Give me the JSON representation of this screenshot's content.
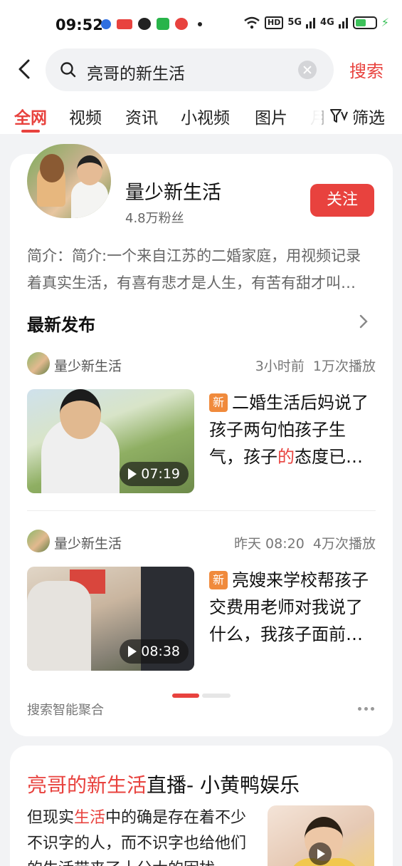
{
  "status_bar": {
    "time": "09:52",
    "network_tag": "HD",
    "signal_5g": "5G",
    "signal_4g": "4G",
    "colors": {
      "battery": "#3cc15a"
    }
  },
  "search": {
    "query": "亮哥的新生活",
    "submit_label": "搜索"
  },
  "tabs": [
    {
      "label": "全网",
      "active": true
    },
    {
      "label": "视频"
    },
    {
      "label": "资讯"
    },
    {
      "label": "小视频"
    },
    {
      "label": "图片"
    },
    {
      "label": "月"
    }
  ],
  "filter_label": "筛选",
  "account": {
    "name": "量少新生活",
    "fans": "4.8万粉丝",
    "follow_label": "关注",
    "intro_line1": "简介：简介:一个来自江苏的二婚家庭，用视频记录",
    "intro_line2": "着真实生活，有喜有悲才是人生，有苦有甜才叫…",
    "latest_title": "最新发布"
  },
  "posts": [
    {
      "author": "量少新生活",
      "time": "3小时前",
      "plays": "1万次播放",
      "badge": "新",
      "title_part1": "二婚生活后妈说了孩子两句怕孩子生气，孩子",
      "title_highlight": "的",
      "title_part2": "态度已…",
      "duration": "07:19"
    },
    {
      "author": "量少新生活",
      "time": "昨天 08:20",
      "plays": "4万次播放",
      "badge": "新",
      "title_part1": "亮嫂来学校帮孩子交费用老师对我说了什么，我孩子面前…",
      "duration": "08:38"
    }
  ],
  "aggregate_label": "搜索智能聚合",
  "card2": {
    "title_highlight": "亮哥的新生活",
    "title_rest": "直播- 小黄鸭娱乐",
    "body_part1": "但现实",
    "body_highlight": "生活",
    "body_part2": "中的确是存在着不少不识字的人，而不识字也给他们的生活带来了十分大的困扰"
  },
  "colors": {
    "accent": "#e8423e",
    "badge": "#f08a3c",
    "page_bg": "#f2f3f5"
  }
}
